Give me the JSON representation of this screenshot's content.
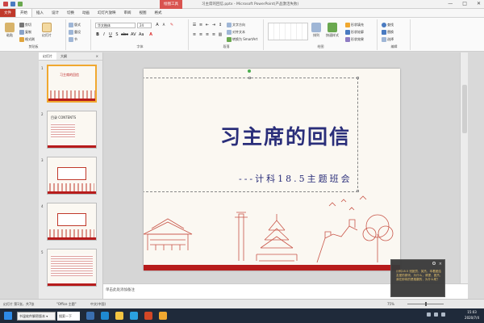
{
  "titlebar": {
    "context_tab": "绘图工具",
    "title": "习主席的回信.pptx - Microsoft PowerPoint(产品激活失败)",
    "min": "—",
    "max": "□",
    "close": "✕"
  },
  "menu": {
    "tabs": [
      "文件",
      "开始",
      "插入",
      "设计",
      "切换",
      "动画",
      "幻灯片放映",
      "审阅",
      "视图",
      "格式"
    ]
  },
  "ribbon": {
    "clipboard": {
      "paste": "粘贴",
      "cut": "剪切",
      "copy": "复制",
      "format_painter": "格式刷",
      "label": "剪贴板"
    },
    "slides": {
      "new_slide": "新建\n幻灯片",
      "layout": "版式",
      "reset": "重设",
      "section": "节",
      "label": "幻灯片"
    },
    "font": {
      "font_name": "华文楷体",
      "font_size": "24",
      "label": "字体"
    },
    "paragraph": {
      "text_direction": "文字方向",
      "align_text": "对齐文本",
      "convert_smartart": "转换为 SmartArt",
      "label": "段落"
    },
    "drawing": {
      "arrange": "排列",
      "quick_styles": "快速样式",
      "shape_fill": "形状填充",
      "shape_outline": "形状轮廓",
      "shape_effects": "形状效果",
      "label": "绘图"
    },
    "editing": {
      "find": "查找",
      "replace": "替换",
      "select": "选择",
      "label": "编辑"
    }
  },
  "pane": {
    "tab_slides": "幻灯片",
    "tab_outline": "大纲",
    "close": "×",
    "thumbs": [
      {
        "num": "1",
        "text": "习主席的回信"
      },
      {
        "num": "2",
        "text": "目录 CONTENTS"
      },
      {
        "num": "3",
        "text": ""
      },
      {
        "num": "4",
        "text": ""
      },
      {
        "num": "5",
        "text": ""
      }
    ]
  },
  "slide": {
    "title": "习主席的回信",
    "subtitle": "---计科18.5主题班会"
  },
  "notes": {
    "placeholder": "单击此处添加备注"
  },
  "status": {
    "slide_pos": "幻灯片 第1张，共7张",
    "theme": "\"Office 主题\"",
    "lang": "中文(中国)",
    "zoom": "75%"
  },
  "taskbar": {
    "search_text": "书温软件解密版本 ▾",
    "search2_text": "搜索一下",
    "time": "15:03",
    "date": "2020/7/4"
  },
  "toast": {
    "message": "计科18.5 班团员、英杰、本着团结友爱的原则，为什么，请提、团杰、我在即将的是推翻的，为什么呢？"
  },
  "colors": {
    "accent_red": "#c0392b",
    "title_blue": "#2a2e7a"
  }
}
